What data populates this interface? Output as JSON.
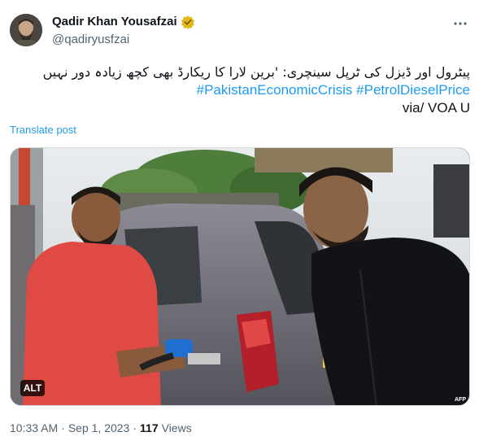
{
  "author": {
    "display_name": "Qadir Khan Yousafzai",
    "handle": "@qadiryusfzai",
    "badge": "verified-gold-icon"
  },
  "more_icon": "more-horizontal-icon",
  "tweet": {
    "urdu_text": "پیٹرول اور ڈیزل کی ٹرپل سینچری: 'برین لارا کا ریکارڈ بھی کچھ زیادہ دور نہیں",
    "hashtags": [
      "#PakistanEconomicCrisis",
      "#PetrolDieselPrice"
    ],
    "via": "via/ VOA U"
  },
  "translate_label": "Translate post",
  "media": {
    "alt_label": "ALT",
    "watermark": "AFP"
  },
  "meta": {
    "time": "10:33 AM",
    "date": "Sep 1, 2023",
    "separator": "·",
    "views_count": "117",
    "views_label": "Views"
  },
  "colors": {
    "accent": "#1d9bf0",
    "secondary_text": "#536471",
    "primary_text": "#0f1419",
    "border": "#cfd9de"
  }
}
